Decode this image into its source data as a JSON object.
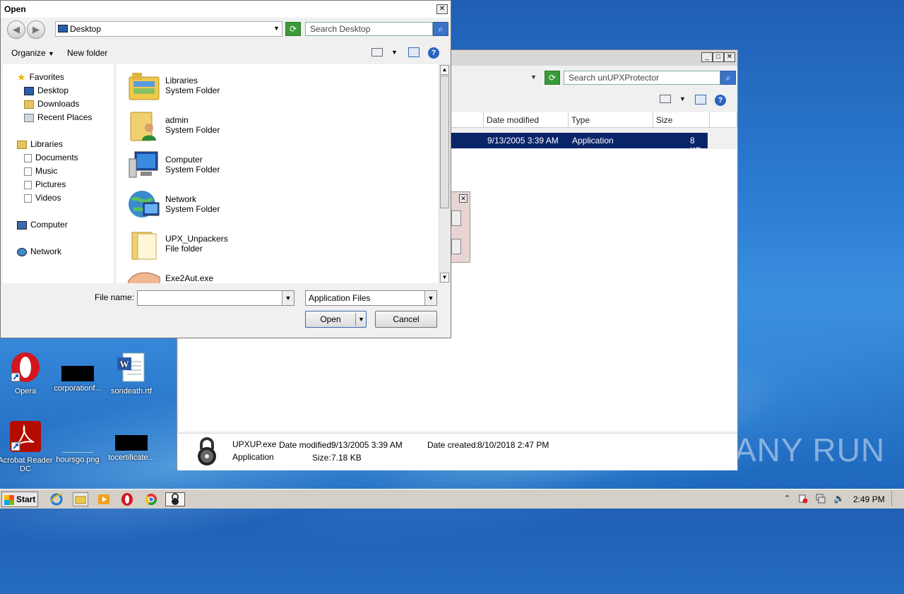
{
  "open_dialog": {
    "title": "Open",
    "address": "Desktop",
    "search_placeholder": "Search Desktop",
    "toolbar": {
      "organize": "Organize",
      "new_folder": "New folder"
    },
    "nav": {
      "favorites": "Favorites",
      "desktop": "Desktop",
      "downloads": "Downloads",
      "recent_places": "Recent Places",
      "libraries": "Libraries",
      "documents": "Documents",
      "music": "Music",
      "pictures": "Pictures",
      "videos": "Videos",
      "computer": "Computer",
      "network": "Network"
    },
    "files": [
      {
        "name": "Libraries",
        "type": "System Folder",
        "icon": "libraries-icon"
      },
      {
        "name": "admin",
        "type": "System Folder",
        "icon": "user-folder-icon"
      },
      {
        "name": "Computer",
        "type": "System Folder",
        "icon": "computer-icon"
      },
      {
        "name": "Network",
        "type": "System Folder",
        "icon": "network-icon"
      },
      {
        "name": "UPX_Unpackers",
        "type": "File folder",
        "icon": "folder-icon"
      },
      {
        "name": "Exe2Aut.exe",
        "type": "",
        "icon": "exe-icon"
      }
    ],
    "file_name_label": "File name:",
    "file_name_value": "",
    "file_type": "Application Files",
    "open_label": "Open",
    "cancel_label": "Cancel"
  },
  "explorer": {
    "search_placeholder": "Search unUPXProtector",
    "columns": [
      "Date modified",
      "Type",
      "Size"
    ],
    "selected_row": {
      "date_modified": "9/13/2005 3:39 AM",
      "type": "Application",
      "size": "8 KB"
    },
    "details": {
      "name": "UPXUP.exe",
      "type": "Application",
      "date_modified_label": "Date modified:",
      "date_modified": "9/13/2005 3:39 AM",
      "date_created_label": "Date created:",
      "date_created": "8/10/2018 2:47 PM",
      "size_label": "Size:",
      "size": "7.18 KB"
    }
  },
  "desktop_icons": [
    {
      "label": "Opera"
    },
    {
      "label": "corporationf..."
    },
    {
      "label": "sondeath.rtf"
    },
    {
      "label": "Acrobat Reader DC"
    },
    {
      "label": "hoursgo.png"
    },
    {
      "label": "tocertificate..."
    }
  ],
  "taskbar": {
    "start_label": "Start",
    "clock": "2:49 PM"
  },
  "watermark": "ANY RUN",
  "colors": {
    "selection": "#0a246a",
    "desktop_blue": "#2a7ad0",
    "dialog_bg": "#f0f0f0"
  }
}
